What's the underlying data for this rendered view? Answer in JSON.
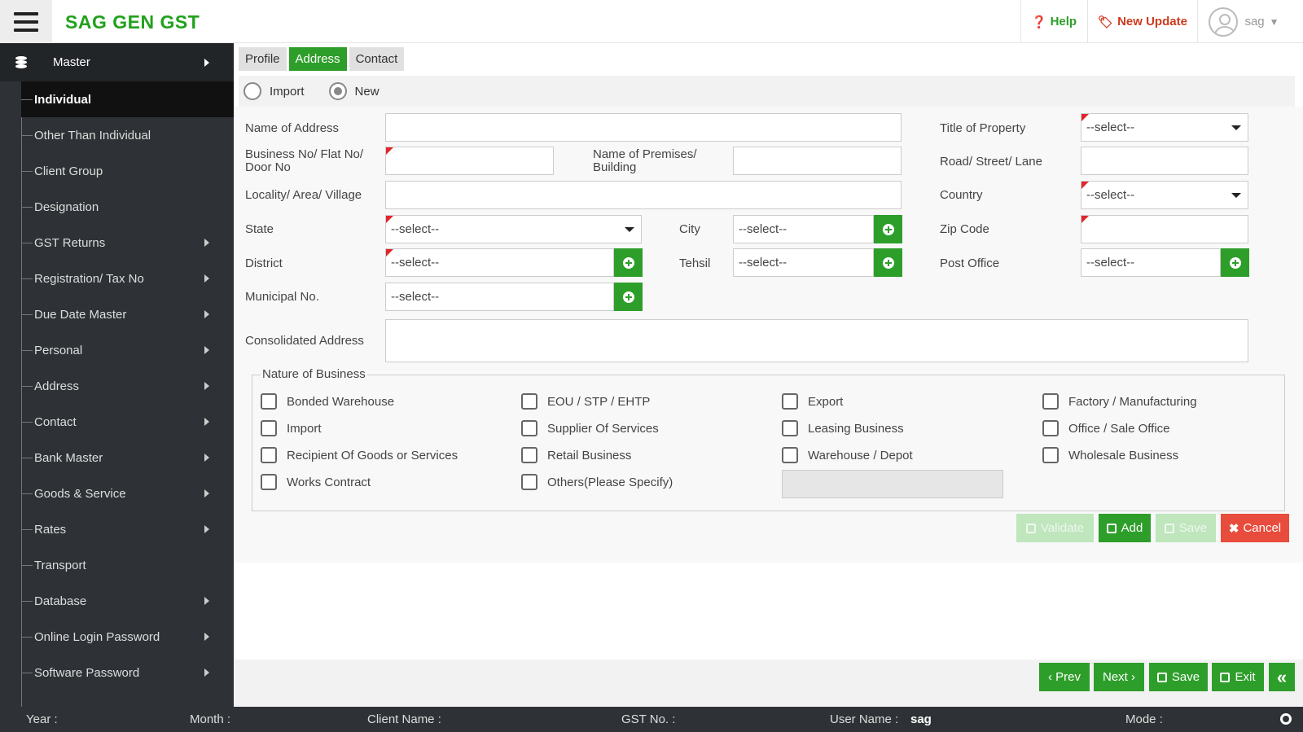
{
  "app": {
    "title": "SAG GEN GST"
  },
  "header": {
    "help": "Help",
    "new_update": "New Update",
    "user": "sag"
  },
  "sidebar": {
    "master": "Master",
    "items": [
      "Individual",
      "Other Than Individual",
      "Client Group",
      "Designation",
      "GST Returns",
      "Registration/ Tax No",
      "Due Date Master",
      "Personal",
      "Address",
      "Contact",
      "Bank Master",
      "Goods & Service",
      "Rates",
      "Transport",
      "Database",
      "Online Login Password",
      "Software Password"
    ],
    "has_submenu": [
      false,
      false,
      false,
      false,
      true,
      true,
      true,
      true,
      true,
      true,
      true,
      true,
      true,
      false,
      true,
      true,
      true
    ],
    "active_index": 0
  },
  "tabs": [
    "Profile",
    "Address",
    "Contact"
  ],
  "active_tab": "Address",
  "radios": {
    "import": "Import",
    "new": "New",
    "selected": "New"
  },
  "form": {
    "name_of_address": "Name of Address",
    "title_of_property": "Title of Property",
    "business_no_1": "Business No/ Flat No/",
    "business_no_2": "Door No",
    "premises_1": "Name of Premises/",
    "premises_2": "Building",
    "road": "Road/ Street/ Lane",
    "locality": "Locality/ Area/ Village",
    "country": "Country",
    "state": "State",
    "city": "City",
    "zip": "Zip Code",
    "district": "District",
    "tehsil": "Tehsil",
    "post_office": "Post Office",
    "municipal": "Municipal No.",
    "consolidated": "Consolidated Address",
    "select_placeholder": "--select--"
  },
  "nature_of_business": {
    "legend": "Nature of Business",
    "options": [
      "Bonded Warehouse",
      "EOU / STP / EHTP",
      "Export",
      "Factory / Manufacturing",
      "Import",
      "Supplier Of Services",
      "Leasing Business",
      "Office / Sale Office",
      "Recipient Of Goods or Services",
      "Retail Business",
      "Warehouse / Depot",
      "Wholesale Business",
      "Works Contract",
      "Others(Please Specify)"
    ]
  },
  "actions": {
    "validate": "Validate",
    "add": "Add",
    "save": "Save",
    "cancel": "Cancel"
  },
  "nav_buttons": {
    "prev": "‹ Prev",
    "next": "Next ›",
    "save": "Save",
    "exit": "Exit",
    "collapse": "«"
  },
  "footer": {
    "year": "Year :",
    "month": "Month :",
    "client": "Client Name :",
    "gst": "GST No. :",
    "username_label": "User Name :",
    "username_value": "sag",
    "mode": "Mode :"
  },
  "colors": {
    "brand": "#22a11c",
    "accent": "#2e9e2a",
    "danger": "#e74c3c",
    "sidebar": "#2e3236"
  }
}
